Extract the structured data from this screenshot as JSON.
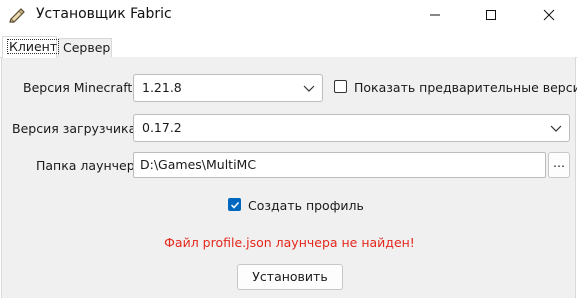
{
  "window": {
    "title": "Установщик Fabric",
    "icon": "fabric-scroll-icon"
  },
  "tabs": [
    {
      "label": "Клиент",
      "selected": true
    },
    {
      "label": "Сервер",
      "selected": false
    }
  ],
  "form": {
    "minecraft_version_label": "Версия Minecraft:",
    "minecraft_version_value": "1.21.8",
    "show_snapshots_label": "Показать предварительные версии",
    "show_snapshots_checked": false,
    "loader_version_label": "Версия загрузчика:",
    "loader_version_value": "0.17.2",
    "launcher_folder_label": "Папка лаунчера:",
    "launcher_folder_value": "D:\\Games\\MultiMC",
    "browse_label": "...",
    "create_profile_label": "Создать профиль",
    "create_profile_checked": true,
    "error_message": "Файл profile.json лаунчера не найден!",
    "install_label": "Установить"
  },
  "colors": {
    "accent": "#0067c0",
    "error": "#e5271c",
    "panel_bg": "#f0f0f0"
  }
}
